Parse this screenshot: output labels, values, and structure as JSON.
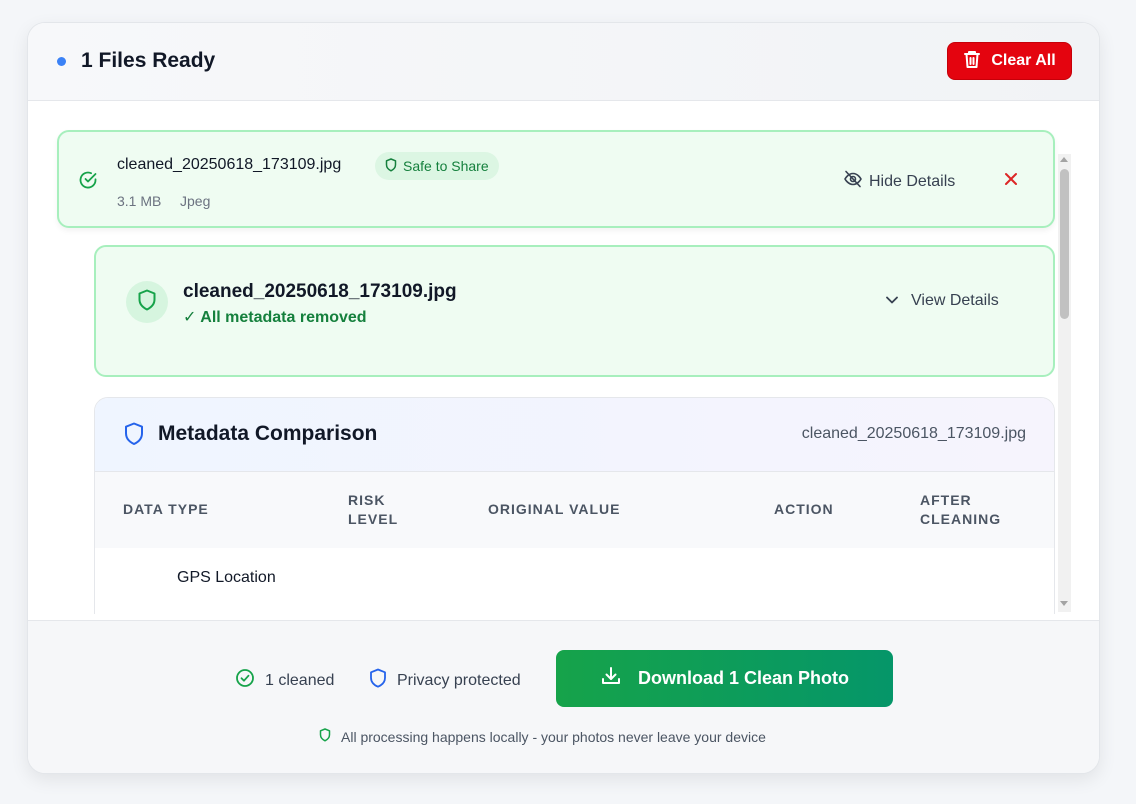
{
  "header": {
    "title": "1 Files Ready",
    "clear_label": "Clear All"
  },
  "file": {
    "name": "cleaned_20250618_173109.jpg",
    "badge": "Safe to Share",
    "size": "3.1 MB",
    "type": "Jpeg",
    "hide_label": "Hide Details"
  },
  "detail": {
    "name": "cleaned_20250618_173109.jpg",
    "status": "✓ All metadata removed",
    "view_label": "View Details"
  },
  "metadata": {
    "title": "Metadata Comparison",
    "file": "cleaned_20250618_173109.jpg",
    "columns": [
      "DATA TYPE",
      "RISK LEVEL",
      "ORIGINAL VALUE",
      "ACTION",
      "AFTER CLEANING"
    ],
    "rows": [
      {
        "data_type": "GPS Location"
      }
    ]
  },
  "footer": {
    "cleaned": "1 cleaned",
    "privacy": "Privacy protected",
    "download_label": "Download 1 Clean Photo",
    "note": "All processing happens locally - your photos never leave your device"
  },
  "colors": {
    "accent_blue": "#3b82f6",
    "danger": "#e4040f",
    "success": "#16a34a"
  }
}
